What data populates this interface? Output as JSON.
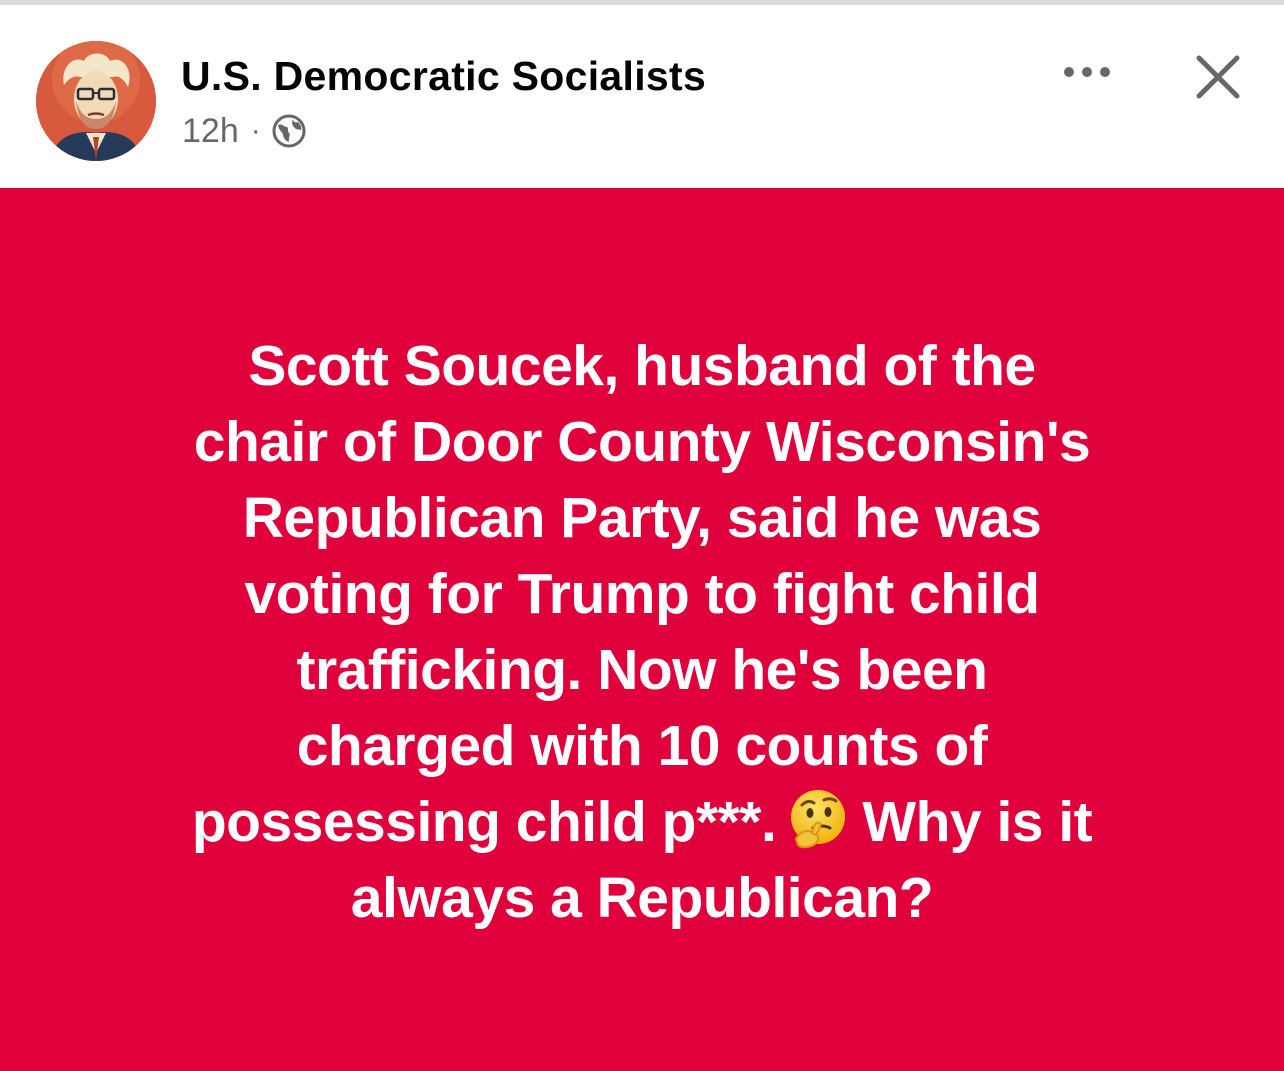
{
  "header": {
    "page_name": "U.S. Democratic Socialists",
    "time": "12h",
    "separator": "·",
    "audience_icon": "globe-icon",
    "more_icon": "more-horizontal-icon",
    "close_icon": "close-icon"
  },
  "post": {
    "background_color": "#e0003b",
    "text_color": "#ffffff",
    "lines": [
      "Scott Soucek, husband of the",
      "chair of Door County Wisconsin's",
      "Republican Party, said he was",
      "voting for Trump to fight child",
      "trafficking. Now he's been",
      "charged with 10 counts of"
    ],
    "line7_before_emoji": "possessing child p***.",
    "emoji": "thinking-face-emoji",
    "line7_after_emoji": "Why is it",
    "last_line": "always a Republican?"
  }
}
